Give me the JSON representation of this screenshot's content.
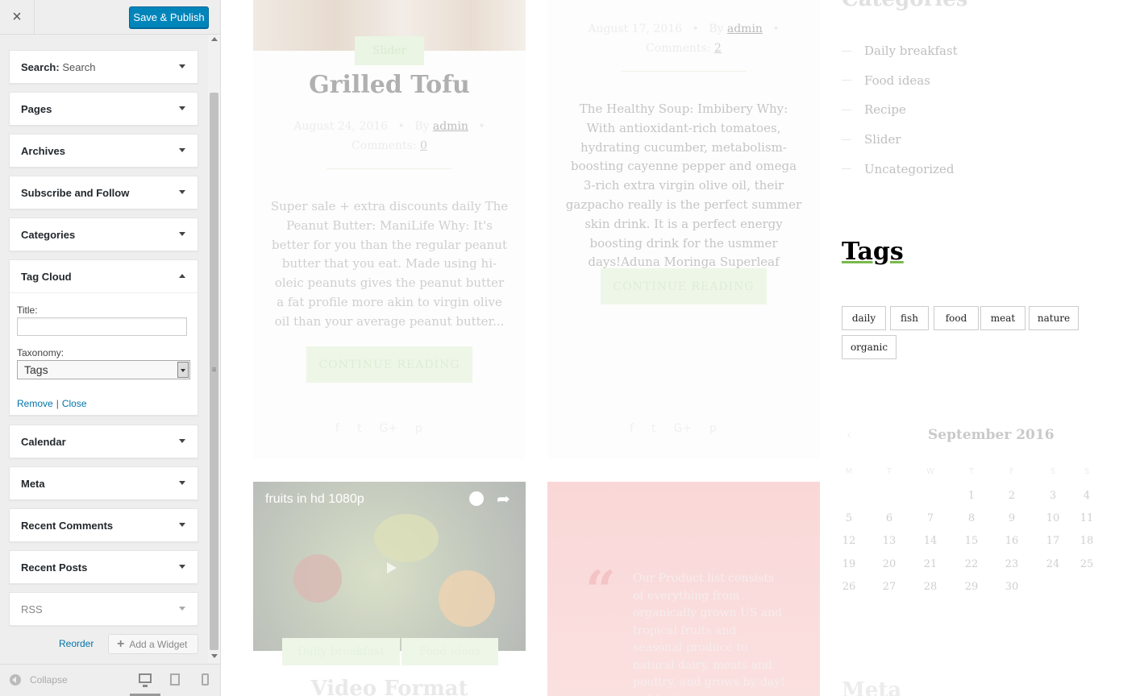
{
  "customizer": {
    "close_icon": "×",
    "publish_label": "Save & Publish",
    "widgets": [
      {
        "title": "Search:",
        "subtitle": "Search"
      },
      {
        "title": "Pages"
      },
      {
        "title": "Archives"
      },
      {
        "title": "Subscribe and Follow"
      },
      {
        "title": "Categories"
      },
      {
        "title": "Tag Cloud",
        "expanded": true
      },
      {
        "title": "Calendar"
      },
      {
        "title": "Meta"
      },
      {
        "title": "Recent Comments"
      },
      {
        "title": "Recent Posts"
      },
      {
        "title": "RSS"
      }
    ],
    "tag_cloud_form": {
      "title_label": "Title:",
      "title_value": "",
      "taxonomy_label": "Taxonomy:",
      "taxonomy_value": "Tags",
      "remove_label": "Remove",
      "separator": "|",
      "close_label": "Close"
    },
    "reorder_label": "Reorder",
    "add_widget_label": "Add a Widget",
    "collapse_label": "Collapse",
    "devices": [
      "desktop-icon",
      "tablet-icon",
      "mobile-icon"
    ],
    "accent_color": "#0085ba"
  },
  "preview": {
    "post1": {
      "category": "Slider",
      "title": "Grilled Tofu",
      "date": "August 24, 2016",
      "by": "By",
      "author": "admin",
      "comments_label": "Comments:",
      "comments_count": "0",
      "excerpt": "Super sale + extra discounts daily The Peanut Butter: ManiLife Why: It's better for you than the regular peanut butter that you eat. Made using hi-oleic peanuts gives the peanut butter a fat profile more akin to virgin olive oil than your average peanut butter...",
      "continue": "CONTINUE READING"
    },
    "post2": {
      "date": "August 17, 2016",
      "by": "By",
      "author": "admin",
      "comments_label": "Comments:",
      "comments_count": "2",
      "excerpt": "The Healthy Soup: Imbibery Why: With antioxidant-rich tomatoes, hydrating cucumber, metabolism-boosting cayenne pepper and omega 3-rich extra virgin olive oil, their gazpacho really is the perfect summer skin drink. It is a perfect energy boosting drink for the usmmer days!Aduna Moringa Superleaf powder is one...",
      "continue": "CONTINUE READING"
    },
    "video_post": {
      "video_title": "fruits in hd 1080p",
      "tag1": "Daily breakfast",
      "tag2": "Food ideas",
      "title": "Video Format"
    },
    "quote_post": {
      "quote_mark": "“",
      "text": "Our Product list consists of everything from organically grown US and tropical fruits and seasonal produce to natural dairy, meats and poultry, and grows by day! — Martin"
    },
    "sidebar": {
      "categories_heading": "Categories",
      "categories": [
        "Daily breakfast",
        "Food ideas",
        "Recipe",
        "Slider",
        "Uncategorized"
      ],
      "tags_heading": "Tags",
      "tags": [
        "daily",
        "fish",
        "food",
        "meat",
        "nature",
        "organic"
      ],
      "calendar": {
        "prev": "‹",
        "title": "September 2016",
        "dow": [
          "M",
          "T",
          "W",
          "T",
          "F",
          "S",
          "S"
        ],
        "weeks": [
          [
            "",
            "",
            "",
            "1",
            "2",
            "3",
            "4"
          ],
          [
            "5",
            "6",
            "7",
            "8",
            "9",
            "10",
            "11"
          ],
          [
            "12",
            "13",
            "14",
            "15",
            "16",
            "17",
            "18"
          ],
          [
            "19",
            "20",
            "21",
            "22",
            "23",
            "24",
            "25"
          ],
          [
            "26",
            "27",
            "28",
            "29",
            "30",
            "",
            ""
          ]
        ]
      },
      "meta_heading": "Meta"
    }
  }
}
